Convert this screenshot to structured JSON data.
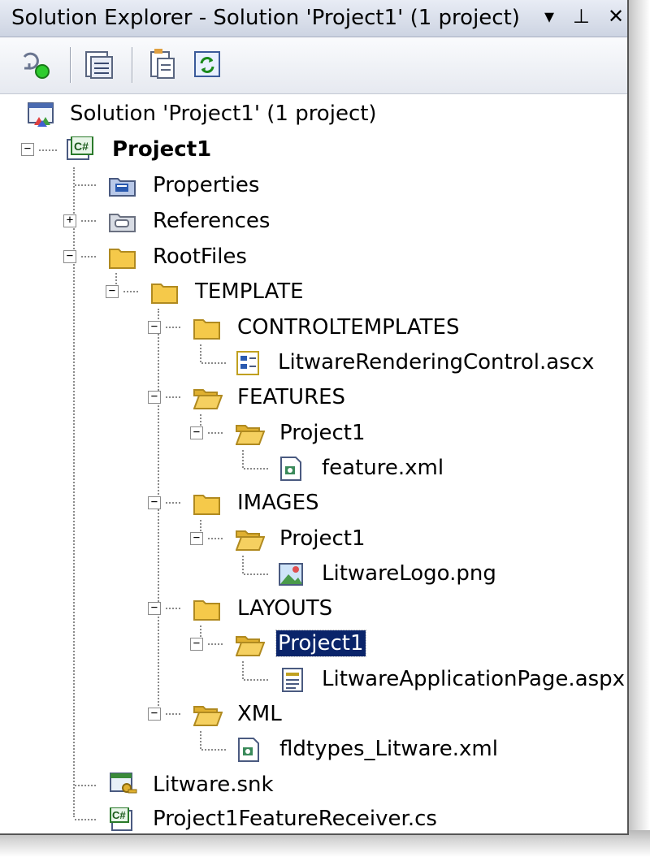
{
  "window": {
    "title": "Solution Explorer - Solution 'Project1' (1 project)",
    "controls": {
      "dropdown": "▾",
      "pin": "⊥",
      "close": "✕"
    }
  },
  "toolbar": {
    "buttons": [
      {
        "name": "properties-button",
        "icon": "properties-icon"
      },
      {
        "name": "show-all-files-button",
        "icon": "show-all-files-icon"
      },
      {
        "name": "view-code-button",
        "icon": "view-code-icon"
      },
      {
        "name": "refresh-button",
        "icon": "refresh-icon"
      }
    ]
  },
  "tree": {
    "solution": "Solution 'Project1' (1 project)",
    "project": "Project1",
    "properties": "Properties",
    "references": "References",
    "rootfiles": "RootFiles",
    "template": "TEMPLATE",
    "controltemplates": "CONTROLTEMPLATES",
    "ascx": "LitwareRenderingControl.ascx",
    "features": "FEATURES",
    "features_project": "Project1",
    "feature_xml": "feature.xml",
    "images": "IMAGES",
    "images_project": "Project1",
    "logo_png": "LitwareLogo.png",
    "layouts": "LAYOUTS",
    "layouts_project": "Project1",
    "aspx": "LitwareApplicationPage.aspx",
    "xml": "XML",
    "fldtypes": "fldtypes_Litware.xml",
    "snk": "Litware.snk",
    "receiver": "Project1FeatureReceiver.cs"
  },
  "colors": {
    "selection": "#0a246a",
    "folder": "#f5c94a",
    "titlebar": "#cdd4e2"
  }
}
